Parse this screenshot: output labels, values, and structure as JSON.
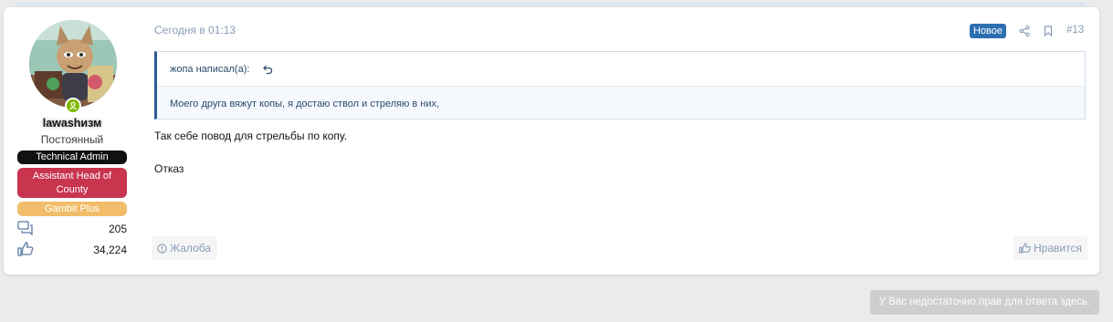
{
  "user": {
    "name": "lawashизм",
    "title": "Постоянный",
    "banners": {
      "tech": "Technical Admin",
      "ahc": "Assistant Head of County",
      "gold": "Gambit Plus"
    },
    "stats": {
      "messages": "205",
      "likes": "34,224"
    },
    "icons": {
      "messages": "messages-icon",
      "likes": "thumbs-up-icon",
      "online": "user-online-icon"
    }
  },
  "post": {
    "date": "Сегодня в 01:13",
    "badge_new": "Новое",
    "number": "#13",
    "quote": {
      "author": "жопа написал(а):",
      "text": "Моего друга вяжут копы, я достаю ствол и стреляю в них,"
    },
    "lines": [
      "Так себе повод для стрельбы по копу.",
      "Отказ"
    ],
    "actions": {
      "report": "Жалоба",
      "like": "Нравится"
    }
  },
  "footer": {
    "no_permission": "У Вас недостаточно прав для ответа здесь."
  },
  "colors": {
    "accent": "#2c6fb0",
    "quote_border": "#2c5b92",
    "banner_tech": "#111111",
    "banner_ahc": "#c9344e",
    "banner_gold": "#f1bd6a",
    "online": "#7fb900"
  }
}
